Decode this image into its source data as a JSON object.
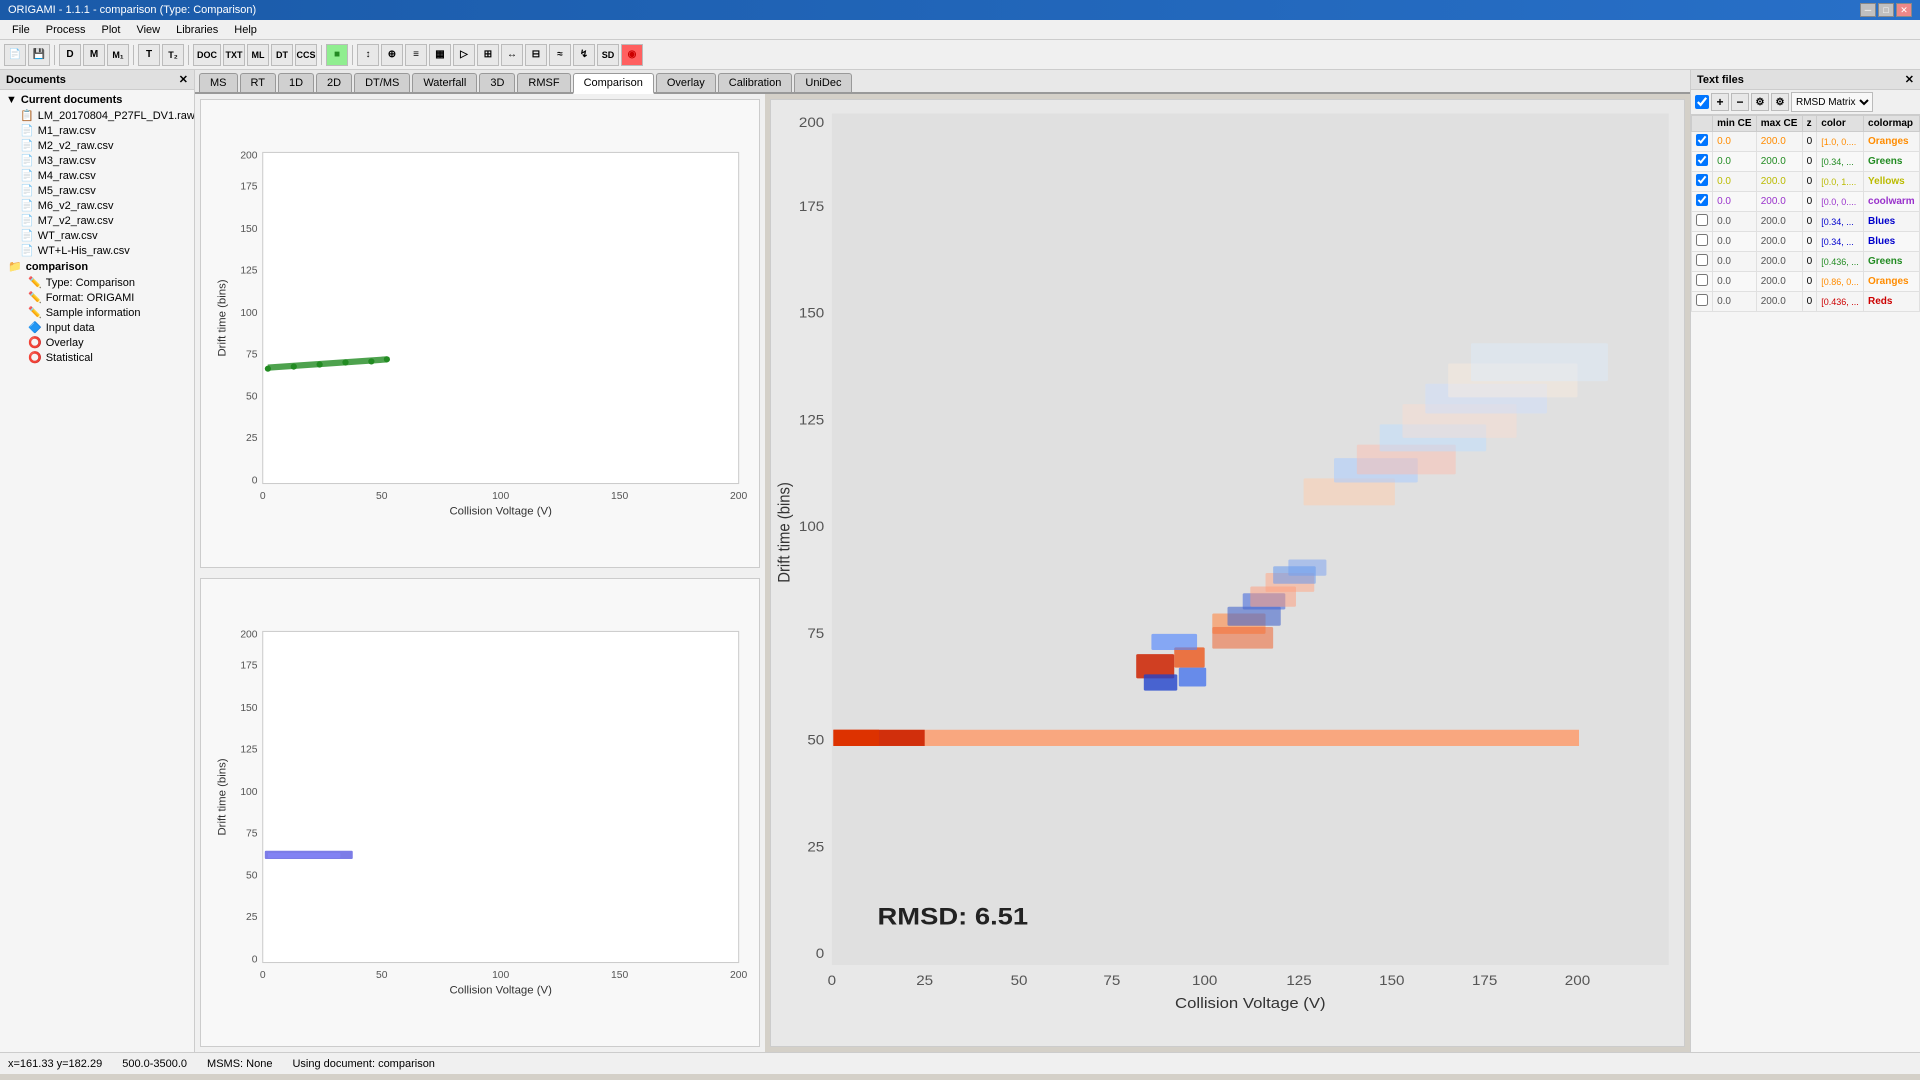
{
  "titleBar": {
    "title": "ORIGAMI - 1.1.1 - comparison (Type: Comparison)",
    "controls": [
      "─",
      "□",
      "✕"
    ]
  },
  "menuBar": {
    "items": [
      "File",
      "Process",
      "Plot",
      "View",
      "Libraries",
      "Help"
    ]
  },
  "toolbar": {
    "buttons": [
      {
        "label": "📄",
        "name": "new"
      },
      {
        "label": "💾",
        "name": "save"
      },
      {
        "label": "D",
        "name": "d"
      },
      {
        "label": "M",
        "name": "m"
      },
      {
        "label": "M₁",
        "name": "m1"
      },
      {
        "label": "T",
        "name": "t"
      },
      {
        "label": "T₂",
        "name": "t2"
      },
      {
        "label": "DOC",
        "name": "doc"
      },
      {
        "label": "TXT",
        "name": "txt"
      },
      {
        "label": "ML",
        "name": "ml"
      },
      {
        "label": "DT",
        "name": "dt"
      },
      {
        "label": "CCS",
        "name": "ccs"
      },
      {
        "label": "■",
        "name": "square",
        "color": "green"
      },
      {
        "label": "↕",
        "name": "arrow1"
      },
      {
        "label": "⊕",
        "name": "add"
      },
      {
        "label": "≡",
        "name": "menu"
      },
      {
        "label": "▦",
        "name": "grid"
      },
      {
        "label": "▷",
        "name": "play"
      },
      {
        "label": "⊞",
        "name": "expand"
      },
      {
        "label": "↔",
        "name": "resize"
      },
      {
        "label": "⊟",
        "name": "collapse"
      },
      {
        "label": "≈",
        "name": "approx"
      },
      {
        "label": "↯",
        "name": "lightning"
      },
      {
        "label": "SD",
        "name": "sd"
      },
      {
        "label": "◉",
        "name": "stop",
        "color": "red"
      }
    ]
  },
  "sidebar": {
    "header": "Documents",
    "closeBtn": "✕",
    "currentDocumentsLabel": "Current documents",
    "items": [
      {
        "label": "LM_20170804_P27FL_DV1.raw",
        "icon": "📋",
        "indent": 1
      },
      {
        "label": "M1_raw.csv",
        "icon": "📄",
        "indent": 1
      },
      {
        "label": "M2_v2_raw.csv",
        "icon": "📄",
        "indent": 1
      },
      {
        "label": "M3_raw.csv",
        "icon": "📄",
        "indent": 1
      },
      {
        "label": "M4_raw.csv",
        "icon": "📄",
        "indent": 1
      },
      {
        "label": "M5_raw.csv",
        "icon": "📄",
        "indent": 1
      },
      {
        "label": "M6_v2_raw.csv",
        "icon": "📄",
        "indent": 1
      },
      {
        "label": "M7_v2_raw.csv",
        "icon": "📄",
        "indent": 1
      },
      {
        "label": "WT_raw.csv",
        "icon": "📄",
        "indent": 1
      },
      {
        "label": "WT+L-His_raw.csv",
        "icon": "📄",
        "indent": 1
      },
      {
        "label": "comparison",
        "icon": "📁",
        "indent": 0,
        "bold": true
      },
      {
        "label": "Type: Comparison",
        "icon": "✏️",
        "indent": 2
      },
      {
        "label": "Format: ORIGAMI",
        "icon": "✏️",
        "indent": 2
      },
      {
        "label": "Sample information",
        "icon": "✏️",
        "indent": 2
      },
      {
        "label": "Input data",
        "icon": "🔷",
        "indent": 2
      },
      {
        "label": "Overlay",
        "icon": "⭕",
        "indent": 2
      },
      {
        "label": "Statistical",
        "icon": "⭕",
        "indent": 2
      }
    ]
  },
  "tabs": {
    "items": [
      "MS",
      "RT",
      "1D",
      "2D",
      "DT/MS",
      "Waterfall",
      "3D",
      "RMSF",
      "Comparison",
      "Overlay",
      "Calibration",
      "UniDec"
    ],
    "active": "Comparison"
  },
  "leftTopChart": {
    "title": "",
    "xLabel": "Collision Voltage (V)",
    "yLabel": "Drift time (bins)",
    "xMin": 0,
    "xMax": 200,
    "yMin": 0,
    "yMax": 200,
    "xTicks": [
      0,
      50,
      100,
      150,
      200
    ],
    "yTicks": [
      25,
      50,
      75,
      100,
      125,
      150,
      175,
      200
    ]
  },
  "leftBottomChart": {
    "xLabel": "Collision Voltage (V)",
    "yLabel": "Drift time (bins)",
    "xMin": 0,
    "xMax": 200,
    "yMin": 0,
    "yMax": 200,
    "xTicks": [
      0,
      50,
      100,
      150,
      200
    ],
    "yTicks": [
      25,
      50,
      75,
      100,
      125,
      150,
      175,
      200
    ]
  },
  "rightChart": {
    "xLabel": "Collision Voltage (V)",
    "yLabel": "Drift time (bins)",
    "xMin": 0,
    "xMax": 200,
    "yMin": 0,
    "yMax": 200,
    "xTicks": [
      0,
      25,
      50,
      75,
      100,
      125,
      150,
      175,
      200
    ],
    "yTicks": [
      25,
      50,
      75,
      100,
      125,
      150,
      175,
      200
    ],
    "rmsd": "RMSD: 6.51"
  },
  "textFilesPanel": {
    "header": "Text files",
    "toolbar": {
      "checkbox": true,
      "plus": "+",
      "minus": "-",
      "settings1": "⚙",
      "settings2": "⚙",
      "dropdown": "RMSD Matrix"
    },
    "columns": [
      "min CE",
      "max CE",
      "z",
      "color",
      "colormap"
    ],
    "rows": [
      {
        "checked": true,
        "minCE": "0.0",
        "maxCE": "200.0",
        "z": "0",
        "color": "[1.0, 0....",
        "colormap": "Oranges",
        "colormapColor": "orange"
      },
      {
        "checked": true,
        "minCE": "0.0",
        "maxCE": "200.0",
        "z": "0",
        "color": "[0.34, ...",
        "colormap": "Greens",
        "colormapColor": "green"
      },
      {
        "checked": true,
        "minCE": "0.0",
        "maxCE": "200.0",
        "z": "0",
        "color": "[0.0, 1....",
        "colormap": "Yellows",
        "colormapColor": "yellow"
      },
      {
        "checked": true,
        "minCE": "0.0",
        "maxCE": "200.0",
        "z": "0",
        "color": "[0.0, 0....",
        "colormap": "coolwarm",
        "colormapColor": "coolwarm"
      },
      {
        "checked": false,
        "minCE": "0.0",
        "maxCE": "200.0",
        "z": "0",
        "color": "[0.34, ...",
        "colormap": "Blues",
        "colormapColor": "blue"
      },
      {
        "checked": false,
        "minCE": "0.0",
        "maxCE": "200.0",
        "z": "0",
        "color": "[0.34, ...",
        "colormap": "Blues",
        "colormapColor": "blue"
      },
      {
        "checked": false,
        "minCE": "0.0",
        "maxCE": "200.0",
        "z": "0",
        "color": "[0.436, ...",
        "colormap": "Greens",
        "colormapColor": "green"
      },
      {
        "checked": false,
        "minCE": "0.0",
        "maxCE": "200.0",
        "z": "0",
        "color": "[0.86, 0...",
        "colormap": "Oranges",
        "colormapColor": "orange"
      },
      {
        "checked": false,
        "minCE": "0.0",
        "maxCE": "200.0",
        "z": "0",
        "color": "[0.436, ...",
        "colormap": "Reds",
        "colormapColor": "red"
      }
    ]
  },
  "statusBar": {
    "coords": "x=161.33 y=182.29",
    "massRange": "500.0-3500.0",
    "msms": "MSMS: None",
    "document": "Using document: comparison"
  }
}
